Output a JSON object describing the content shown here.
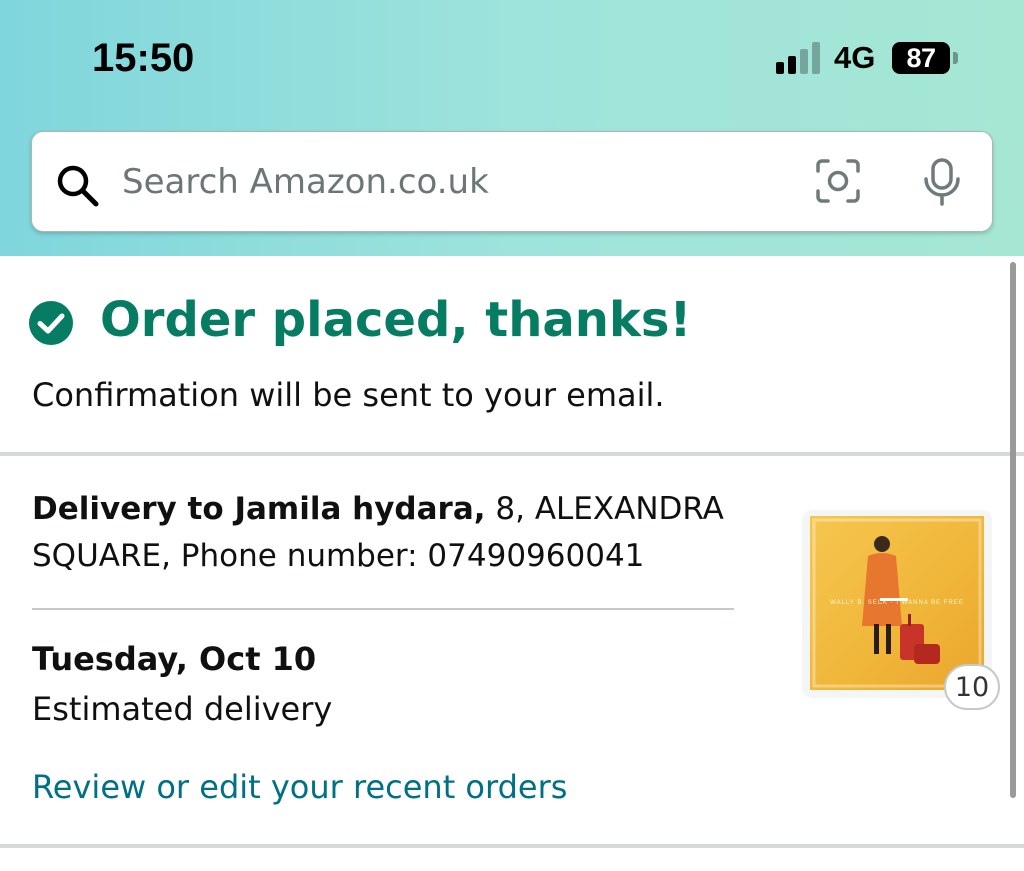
{
  "status_bar": {
    "time": "15:50",
    "network": "4G",
    "battery": "87",
    "signal_bars_active": 2,
    "signal_bars_total": 4
  },
  "search": {
    "placeholder": "Search Amazon.co.uk",
    "icons": [
      "search-icon",
      "camera-icon",
      "microphone-icon"
    ]
  },
  "confirmation": {
    "title": "Order placed, thanks!",
    "subtitle": "Confirmation will be sent to your email.",
    "icon": "check-circle-icon"
  },
  "delivery": {
    "recipient_label": "Delivery to Jamila hydara,",
    "address_text": " 8, ALEXANDRA SQUARE, Phone number: 07490960041",
    "date": "Tuesday, Oct 10",
    "date_caption": "Estimated delivery",
    "orders_link": "Review or edit your recent orders"
  },
  "item": {
    "cover_text": "WALLY B. SECK · I WANNA BE FREE",
    "quantity": "10"
  },
  "colors": {
    "success_green": "#067d62",
    "link_teal": "#007185",
    "header_gradient_start": "#7fd6dc",
    "header_gradient_end": "#a6e7d4"
  }
}
